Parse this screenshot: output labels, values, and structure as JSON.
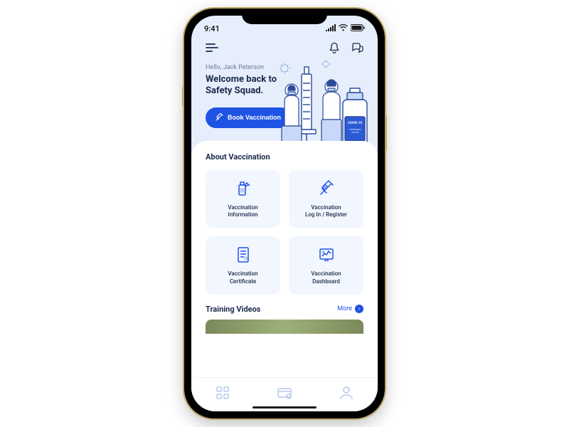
{
  "status": {
    "time": "9:41"
  },
  "hero": {
    "greeting": "Hello, Jack Peterson",
    "welcome": "Welcome back to Safety Squad.",
    "cta_label": "Book Vaccination",
    "bottle_label": "COVID-19"
  },
  "about": {
    "title": "About Vaccination",
    "tiles": [
      {
        "label": "Vaccination\nInformation"
      },
      {
        "label": "Vaccination\nLog In / Register"
      },
      {
        "label": "Vaccination\nCertificate"
      },
      {
        "label": "Vaccination\nDashboard"
      }
    ]
  },
  "videos": {
    "title": "Training Videos",
    "more_label": "More"
  }
}
